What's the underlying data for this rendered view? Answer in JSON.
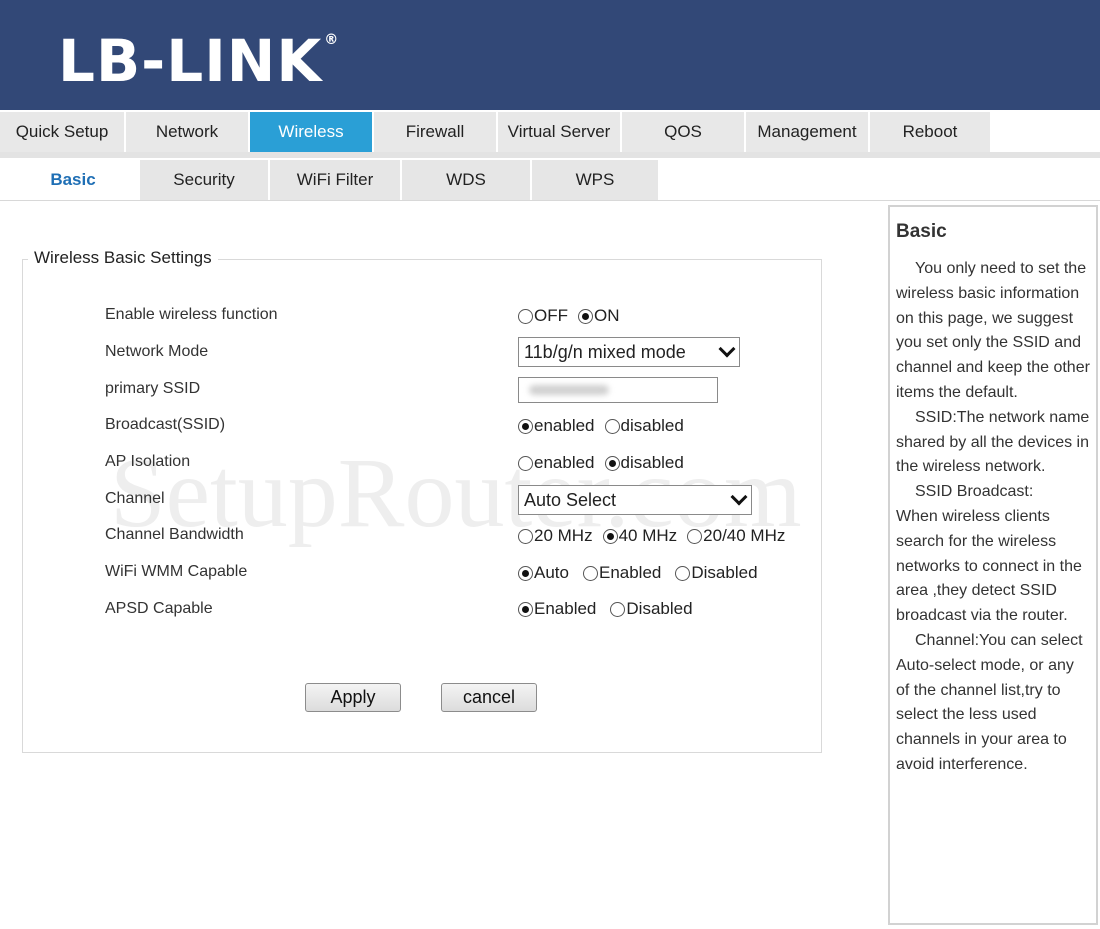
{
  "brand": {
    "logo_text": "LB-LINK",
    "registered_mark": "®",
    "header_color": "#324877",
    "active_tab_color": "#2a9fd6"
  },
  "main_nav": [
    {
      "label": "Quick Setup",
      "active": false
    },
    {
      "label": "Network",
      "active": false
    },
    {
      "label": "Wireless",
      "active": true
    },
    {
      "label": "Firewall",
      "active": false
    },
    {
      "label": "Virtual Server",
      "active": false
    },
    {
      "label": "QOS",
      "active": false
    },
    {
      "label": "Management",
      "active": false
    },
    {
      "label": "Reboot",
      "active": false
    }
  ],
  "sub_nav": [
    {
      "label": "Basic",
      "active": true
    },
    {
      "label": "Security",
      "active": false
    },
    {
      "label": "WiFi Filter",
      "active": false
    },
    {
      "label": "WDS",
      "active": false
    },
    {
      "label": "WPS",
      "active": false
    }
  ],
  "form": {
    "legend": "Wireless Basic Settings",
    "enable_wireless": {
      "label": "Enable wireless function",
      "options": [
        "OFF",
        "ON"
      ],
      "selected": "ON"
    },
    "network_mode": {
      "label": "Network Mode",
      "value": "11b/g/n mixed mode"
    },
    "primary_ssid": {
      "label": "primary SSID",
      "value": ""
    },
    "broadcast_ssid": {
      "label": "Broadcast(SSID)",
      "options": [
        "enabled",
        "disabled"
      ],
      "selected": "enabled"
    },
    "ap_isolation": {
      "label": "AP Isolation",
      "options": [
        "enabled",
        "disabled"
      ],
      "selected": "disabled"
    },
    "channel": {
      "label": "Channel",
      "value": "Auto Select"
    },
    "channel_bandwidth": {
      "label": "Channel Bandwidth",
      "options": [
        "20 MHz",
        "40 MHz",
        "20/40 MHz"
      ],
      "selected": "40 MHz"
    },
    "wmm": {
      "label": "WiFi WMM Capable",
      "options": [
        "Auto",
        "Enabled",
        "Disabled"
      ],
      "selected": "Auto"
    },
    "apsd": {
      "label": "APSD Capable",
      "options": [
        "Enabled",
        "Disabled"
      ],
      "selected": "Enabled"
    },
    "apply_label": "Apply",
    "cancel_label": "cancel"
  },
  "help": {
    "title": "Basic",
    "paragraphs": [
      {
        "text": "You only need to set the wireless basic information on this page, we suggest you set only the SSID and channel and keep the other items the default.",
        "indent": true
      },
      {
        "text": "SSID:The network name shared by all the devices in the wireless network.",
        "indent": true
      },
      {
        "text": "SSID Broadcast:",
        "indent": true
      },
      {
        "text": "When wireless clients search for the wireless networks to connect in the area ,they detect SSID broadcast via the router.",
        "indent": false
      },
      {
        "text": "Channel:You can select Auto-select mode, or any of the channel list,try to select the less used channels in your area to avoid interference.",
        "indent": true
      }
    ]
  },
  "watermark": "SetupRouter.com"
}
